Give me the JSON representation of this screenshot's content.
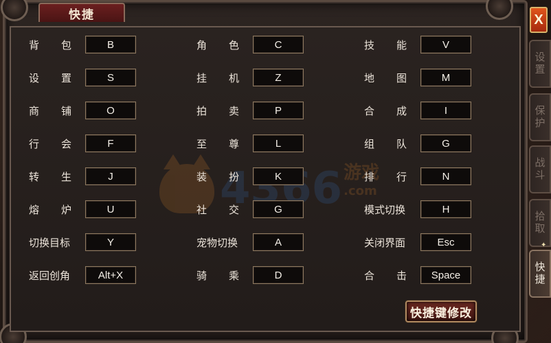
{
  "window": {
    "title": "快捷"
  },
  "close": {
    "label": "X"
  },
  "side_tabs": [
    {
      "label": "设置",
      "active": false
    },
    {
      "label": "保护",
      "active": false
    },
    {
      "label": "战斗",
      "active": false
    },
    {
      "label": "拾取",
      "active": false
    },
    {
      "label": "快捷",
      "active": true
    }
  ],
  "shortcuts": [
    [
      {
        "name": "背　包",
        "key": "B"
      },
      {
        "name": "角　色",
        "key": "C"
      },
      {
        "name": "技　能",
        "key": "V"
      }
    ],
    [
      {
        "name": "设　置",
        "key": "S"
      },
      {
        "name": "挂　机",
        "key": "Z"
      },
      {
        "name": "地　图",
        "key": "M"
      }
    ],
    [
      {
        "name": "商　铺",
        "key": "O"
      },
      {
        "name": "拍　卖",
        "key": "P"
      },
      {
        "name": "合　成",
        "key": "I"
      }
    ],
    [
      {
        "name": "行　会",
        "key": "F"
      },
      {
        "name": "至　尊",
        "key": "L"
      },
      {
        "name": "组　队",
        "key": "G"
      }
    ],
    [
      {
        "name": "转　生",
        "key": "J"
      },
      {
        "name": "装　扮",
        "key": "K"
      },
      {
        "name": "排　行",
        "key": "N"
      }
    ],
    [
      {
        "name": "熔　炉",
        "key": "U"
      },
      {
        "name": "社　交",
        "key": "G"
      },
      {
        "name": "模式切换",
        "key": "H"
      }
    ],
    [
      {
        "name": "切换目标",
        "key": "Y"
      },
      {
        "name": "宠物切换",
        "key": "A"
      },
      {
        "name": "关闭界面",
        "key": "Esc"
      }
    ],
    [
      {
        "name": "返回创角",
        "key": "Alt+X"
      },
      {
        "name": "骑　乘",
        "key": "D"
      },
      {
        "name": "合　击",
        "key": "Space"
      }
    ]
  ],
  "modify_button": {
    "label": "快捷键修改"
  },
  "watermark": {
    "number": "4366",
    "suffix": "游戏",
    "domain": ".com"
  },
  "colors": {
    "accent": "#6b1f1f",
    "close": "#e0551c",
    "key_border": "#8f7a60"
  }
}
